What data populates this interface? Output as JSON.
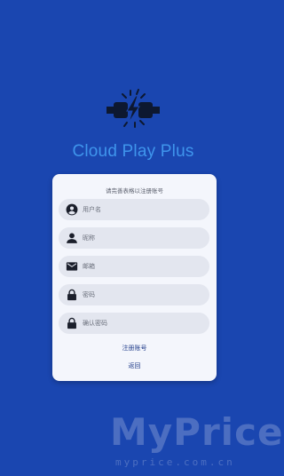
{
  "app": {
    "title": "Cloud Play Plus",
    "logo_icon": "lightning-plug-icon"
  },
  "form": {
    "hint": "请完善表格以注册账号",
    "fields": [
      {
        "icon": "account-circle-icon",
        "placeholder": "用户名"
      },
      {
        "icon": "person-icon",
        "placeholder": "昵称"
      },
      {
        "icon": "mail-icon",
        "placeholder": "邮箱"
      },
      {
        "icon": "lock-icon",
        "placeholder": "密码"
      },
      {
        "icon": "lock-icon",
        "placeholder": "确认密码"
      }
    ],
    "register_label": "注册账号",
    "back_label": "返回"
  },
  "watermark": {
    "text": "MyPrice",
    "sub": "myprice.com.cn"
  },
  "colors": {
    "background": "#1a46b0",
    "title": "#3f95ec",
    "card": "#f4f6fc",
    "field": "#e3e6ef",
    "link": "#233f8c"
  }
}
